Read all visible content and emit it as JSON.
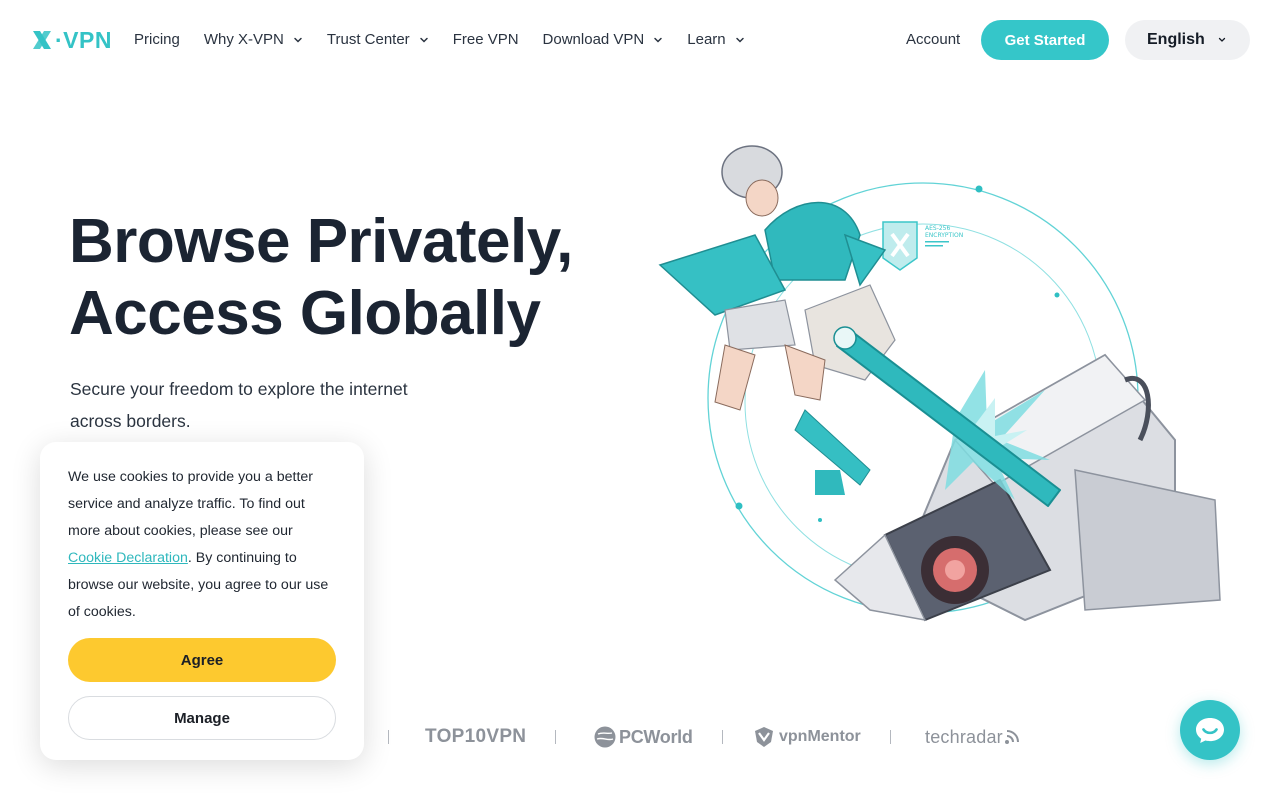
{
  "brand": {
    "name": "X-VPN",
    "logo_text": "·VPN",
    "accent_color": "#35c6c9",
    "cta_color": "#fdc92f"
  },
  "nav": {
    "items": [
      {
        "label": "Pricing",
        "has_dropdown": false
      },
      {
        "label": "Why X-VPN",
        "has_dropdown": true
      },
      {
        "label": "Trust Center",
        "has_dropdown": true
      },
      {
        "label": "Free VPN",
        "has_dropdown": false
      },
      {
        "label": "Download VPN",
        "has_dropdown": true
      },
      {
        "label": "Learn",
        "has_dropdown": true
      }
    ],
    "account_label": "Account",
    "get_started_label": "Get Started",
    "language_selected": "English"
  },
  "hero": {
    "title_line1": "Browse Privately,",
    "title_line2": "Access Globally",
    "subtitle": "Secure your freedom to explore the internet across borders.",
    "art_badge_line1": "AES-256",
    "art_badge_line2": "ENCRYPTION"
  },
  "press": {
    "logos": [
      "TOP10VPN",
      "PCWorld",
      "vpnMentor",
      "techradar"
    ]
  },
  "cookie_banner": {
    "text_before_link": "We use cookies to provide you a better service and analyze traffic. To find out more about cookies, please see our ",
    "link_label": "Cookie Declaration",
    "text_after_link": ". By continuing to browse our website, you agree to our use of cookies.",
    "agree_label": "Agree",
    "manage_label": "Manage"
  },
  "icons": {
    "chat": "chat-bubble-icon",
    "dropdown": "chevron-down-icon",
    "logo": "x-logo-icon"
  }
}
